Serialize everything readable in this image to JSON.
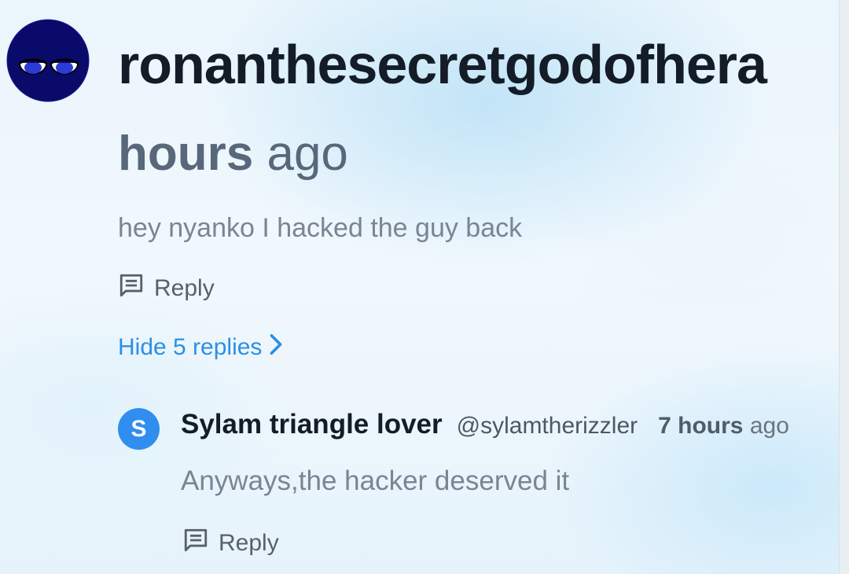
{
  "comment": {
    "username": "ronanthesecretgodofhera",
    "time_value": "hours",
    "time_suffix": " ago",
    "text": "hey nyanko I hacked the guy back",
    "reply_label": "Reply",
    "hide_replies_label": "Hide 5 replies"
  },
  "reply": {
    "avatar_letter": "S",
    "name": "Sylam triangle lover",
    "handle": "@sylamtherizzler",
    "time_value": "7 hours",
    "time_suffix": " ago",
    "text": "Anyways,the hacker deserved it",
    "reply_label": "Reply"
  },
  "colors": {
    "link": "#2d8fe3",
    "reply_avatar": "#2f8ef0",
    "main_avatar": "#0a0a6b"
  },
  "icons": {
    "reply": "comment-icon",
    "chevron": "chevron-right-icon"
  }
}
